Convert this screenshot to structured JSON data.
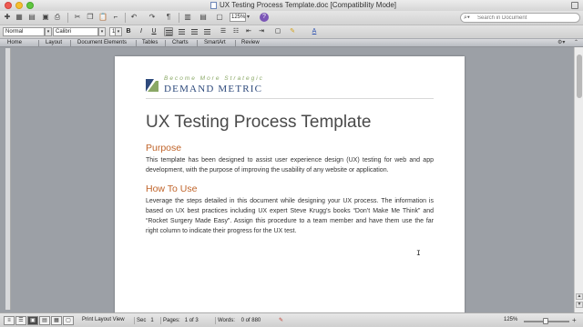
{
  "window": {
    "title": "UX Testing Process Template.doc [Compatibility Mode]"
  },
  "toolbar": {
    "zoom_value": "125%",
    "search_placeholder": "Search in Document"
  },
  "format_bar": {
    "style": "Normal",
    "font": "Calibri",
    "size": "10",
    "bold": "B",
    "italic": "I",
    "underline": "U"
  },
  "ribbon": {
    "tabs": [
      "Home",
      "Layout",
      "Document Elements",
      "Tables",
      "Charts",
      "SmartArt",
      "Review"
    ]
  },
  "document": {
    "logo_tagline": "Become More Strategic",
    "logo_name": "Demand Metric",
    "title": "UX Testing Process Template",
    "sections": [
      {
        "heading": "Purpose",
        "body": "This template has been designed to assist user experience design (UX) testing for web and app development, with the purpose of improving the usability of any website or application."
      },
      {
        "heading": "How To Use",
        "body": "Leverage the steps detailed in this document while designing your UX process. The information is based on UX best practices including UX expert Steve Krugg’s books “Don’t Make Me Think” and “Rocket Surgery Made Easy”. Assign this procedure to a team member and have them use the far right column to indicate their progress for the UX test."
      }
    ]
  },
  "status": {
    "view_label": "Print Layout View",
    "sec_label": "Sec",
    "sec_value": "1",
    "pages_label": "Pages:",
    "pages_value": "1 of 3",
    "words_label": "Words:",
    "words_value": "0 of 880",
    "zoom": "125%"
  },
  "colors": {
    "heading_orange": "#c0642a",
    "logo_blue": "#2e4a7c",
    "logo_green": "#8aa866"
  }
}
